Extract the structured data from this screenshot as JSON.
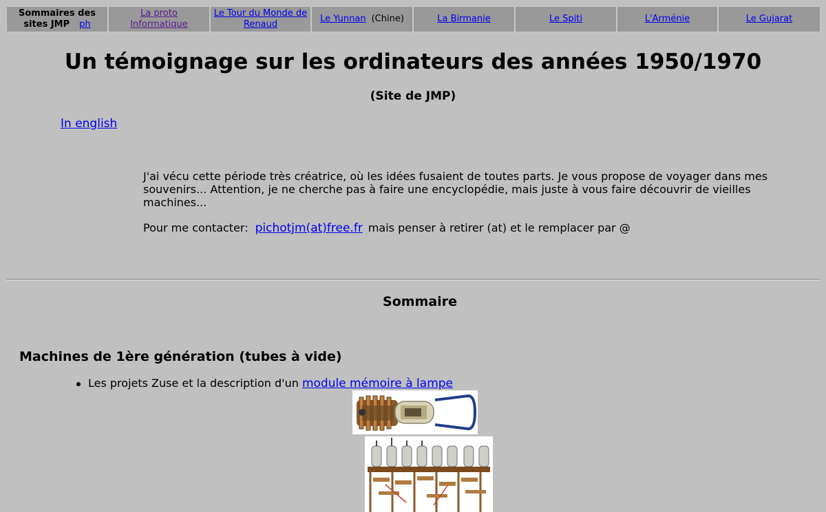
{
  "nav": {
    "sommaire_line1": "Sommaires des",
    "sommaire_line2": "sites JMP",
    "ph": "ph",
    "items": [
      {
        "label": "La proto Informatique"
      },
      {
        "label": "Le Tour du Monde de Renaud"
      },
      {
        "label": "Le Yunnan",
        "suffix": "(Chine)"
      },
      {
        "label": "La Birmanie"
      },
      {
        "label": "Le Spiti"
      },
      {
        "label": "L'Arménie"
      },
      {
        "label": "Le Gujarat"
      }
    ]
  },
  "header": {
    "title": "Un témoignage sur les ordinateurs des années 1950/1970",
    "subtitle": "(Site de JMP)",
    "english_link": "In english"
  },
  "intro": {
    "text": "J'ai vécu cette période très créatrice, où les idées fusaient de toutes parts. Je vous propose de voyager dans mes souvenirs... Attention, je ne cherche pas à faire une encyclopédie, mais juste à vous faire découvrir de vieilles machines...",
    "contact_prefix": "Pour me contacter:",
    "contact_email": "pichotjm(at)free.fr",
    "contact_suffix": "mais penser à retirer (at) et le remplacer par @"
  },
  "sommaire": {
    "title": "Sommaire",
    "section_title": "Machines de 1ère génération (tubes à vide)",
    "items": [
      {
        "text": "Les projets Zuse et la description d'un",
        "link": "module mémoire à lampe"
      }
    ]
  }
}
